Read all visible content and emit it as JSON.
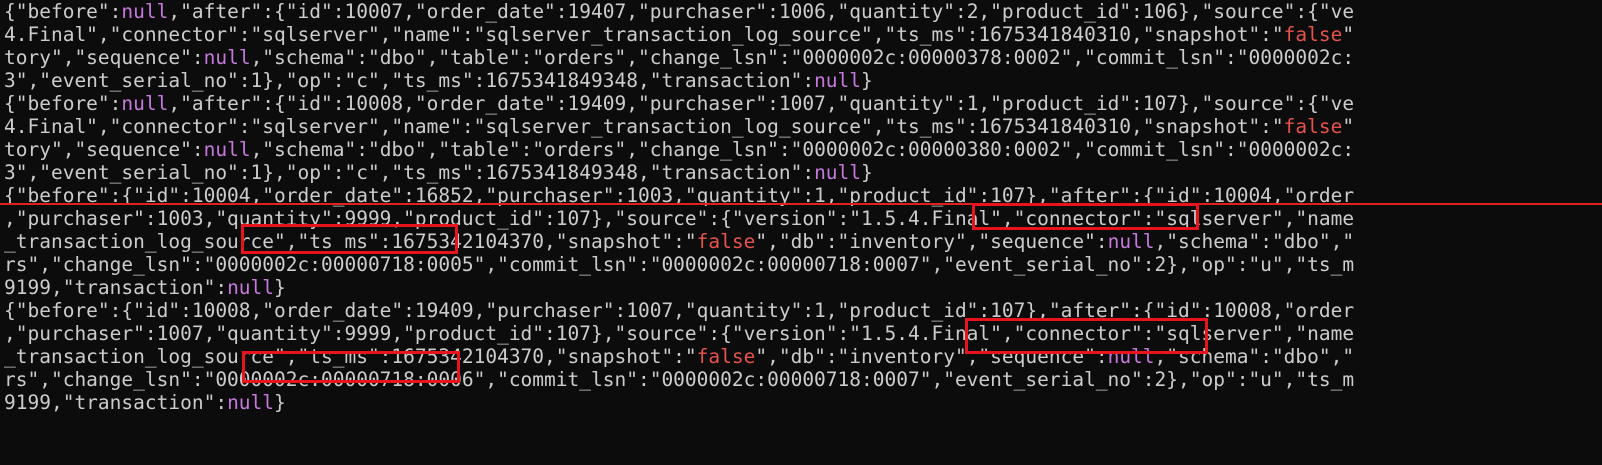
{
  "terminal": {
    "lines": [
      "{\"before\":null,\"after\":{\"id\":10007,\"order_date\":19407,\"purchaser\":1006,\"quantity\":2,\"product_id\":106},\"source\":{\"ve",
      "4.Final\",\"connector\":\"sqlserver\",\"name\":\"sqlserver_transaction_log_source\",\"ts_ms\":1675341840310,\"snapshot\":\"false\"",
      "tory\",\"sequence\":null,\"schema\":\"dbo\",\"table\":\"orders\",\"change_lsn\":\"0000002c:00000378:0002\",\"commit_lsn\":\"0000002c:",
      "3\",\"event_serial_no\":1},\"op\":\"c\",\"ts_ms\":1675341849348,\"transaction\":null}",
      "{\"before\":null,\"after\":{\"id\":10008,\"order_date\":19409,\"purchaser\":1007,\"quantity\":1,\"product_id\":107},\"source\":{\"ve",
      "4.Final\",\"connector\":\"sqlserver\",\"name\":\"sqlserver_transaction_log_source\",\"ts_ms\":1675341840310,\"snapshot\":\"false\"",
      "tory\",\"sequence\":null,\"schema\":\"dbo\",\"table\":\"orders\",\"change_lsn\":\"0000002c:00000380:0002\",\"commit_lsn\":\"0000002c:",
      "3\",\"event_serial_no\":1},\"op\":\"c\",\"ts_ms\":1675341849348,\"transaction\":null}",
      "{\"before\":{\"id\":10004,\"order_date\":16852,\"purchaser\":1003,\"quantity\":1,\"product_id\":107},\"after\":{\"id\":10004,\"order",
      ",\"purchaser\":1003,\"quantity\":9999,\"product_id\":107},\"source\":{\"version\":\"1.5.4.Final\",\"connector\":\"sqlserver\",\"name",
      "_transaction_log_source\",\"ts_ms\":1675342104370,\"snapshot\":\"false\",\"db\":\"inventory\",\"sequence\":null,\"schema\":\"dbo\",\"",
      "rs\",\"change_lsn\":\"0000002c:00000718:0005\",\"commit_lsn\":\"0000002c:00000718:0007\",\"event_serial_no\":2},\"op\":\"u\",\"ts_m",
      "9199,\"transaction\":null}",
      "{\"before\":{\"id\":10008,\"order_date\":19409,\"purchaser\":1007,\"quantity\":1,\"product_id\":107},\"after\":{\"id\":10008,\"order",
      ",\"purchaser\":1007,\"quantity\":9999,\"product_id\":107},\"source\":{\"version\":\"1.5.4.Final\",\"connector\":\"sqlserver\",\"name",
      "_transaction_log_source\",\"ts_ms\":1675342104370,\"snapshot\":\"false\",\"db\":\"inventory\",\"sequence\":null,\"schema\":\"dbo\",\"",
      "rs\",\"change_lsn\":\"0000002c:00000718:0006\",\"commit_lsn\":\"0000002c:00000718:0007\",\"event_serial_no\":2},\"op\":\"u\",\"ts_m",
      "9199,\"transaction\":null}"
    ]
  },
  "colors": {
    "background": "#0c0c0c",
    "text": "#cccccc",
    "null_keyword": "#c678dd",
    "false_string": "#e5534b",
    "highlight_border": "#e8141c",
    "separator": "#e02020"
  },
  "highlights": [
    {
      "text": "\"product_id\":107"
    },
    {
      "text": "\"quantity\":9999"
    },
    {
      "text": "\"product_id\":107"
    },
    {
      "text": "\"quantity\":9999"
    }
  ]
}
